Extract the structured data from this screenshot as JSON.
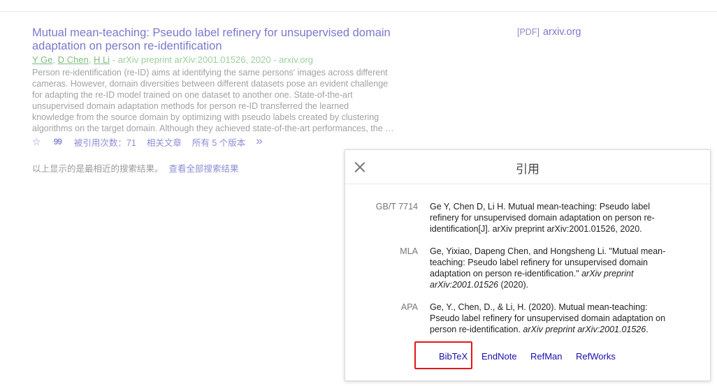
{
  "result": {
    "title_lines": [
      "Mutual mean-teaching: Pseudo label refinery for unsupervised domain",
      "adaptation on person re-identification"
    ],
    "authors": [
      "Y Ge",
      "D Chen",
      "H Li"
    ],
    "source": " - arXiv preprint arXiv:2001.01526, 2020 - arxiv.org",
    "snippet_lines": [
      "Person re-identification (re-ID) aims at identifying the same persons' images across different",
      "cameras. However, domain diversities between different datasets pose an evident challenge",
      "for adapting the re-ID model trained on one dataset to another one. State-of-the-art",
      "unsupervised domain adaptation methods for person re-ID transferred the learned",
      "knowledge from the source domain by optimizing with pseudo labels created by clustering",
      "algorithms on the target domain. Although they achieved state-of-the-art performances, the …"
    ],
    "actions": {
      "save_icon": "☆",
      "cite_icon": "99",
      "cited_by": "被引用次数：71",
      "related": "相关文章",
      "versions": "所有 5 个版本",
      "more_icon": "»"
    },
    "pdf": {
      "tag": "[PDF]",
      "domain": "arxiv.org"
    }
  },
  "recent": {
    "text": "以上显示的是最相近的搜索结果。",
    "link": "查看全部搜索结果"
  },
  "dialog": {
    "title": "引用",
    "citations": [
      {
        "label": "GB/T 7714",
        "lines": [
          "Ge Y, Chen D, Li H. Mutual mean-teaching: Pseudo label",
          "refinery for unsupervised domain adaptation on person re-",
          "identification[J]. arXiv preprint arXiv:2001.01526, 2020."
        ]
      },
      {
        "label": "MLA",
        "lines": [
          "Ge, Yixiao, Dapeng Chen, and Hongsheng Li. \"Mutual mean-",
          "teaching: Pseudo label refinery for unsupervised domain",
          "adaptation on person re-identification.\" "
        ],
        "italic_a": "arXiv preprint",
        "line4_italic": "arXiv:2001.01526",
        "line4_rest": " (2020)."
      },
      {
        "label": "APA",
        "lines": [
          "Ge, Y., Chen, D., & Li, H. (2020). Mutual mean-teaching:",
          "Pseudo label refinery for unsupervised domain adaptation on",
          "person re-identification. "
        ],
        "italic_a": "arXiv preprint arXiv:2001.01526",
        "tail": "."
      }
    ],
    "exports": [
      "BibTeX",
      "EndNote",
      "RefMan",
      "RefWorks"
    ],
    "highlight_color": "#e31818"
  }
}
